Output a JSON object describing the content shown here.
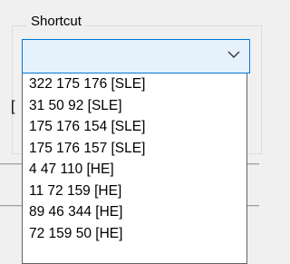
{
  "shortcut_group": {
    "title": "Shortcut",
    "combobox": {
      "value": "",
      "icon": "chevron-down-icon"
    },
    "options": [
      "322 175 176 [SLE]",
      "31 50 92 [SLE]",
      "175 176 154 [SLE]",
      "175 176 157 [SLE]",
      "4 47 110 [HE]",
      "11 72 159 [HE]",
      "89 46 344 [HE]",
      "72 159 50 [HE]"
    ]
  },
  "colors": {
    "focus_border": "#0078d7",
    "combo_background": "#e5f1fb",
    "window_background": "#f0f0f0"
  }
}
